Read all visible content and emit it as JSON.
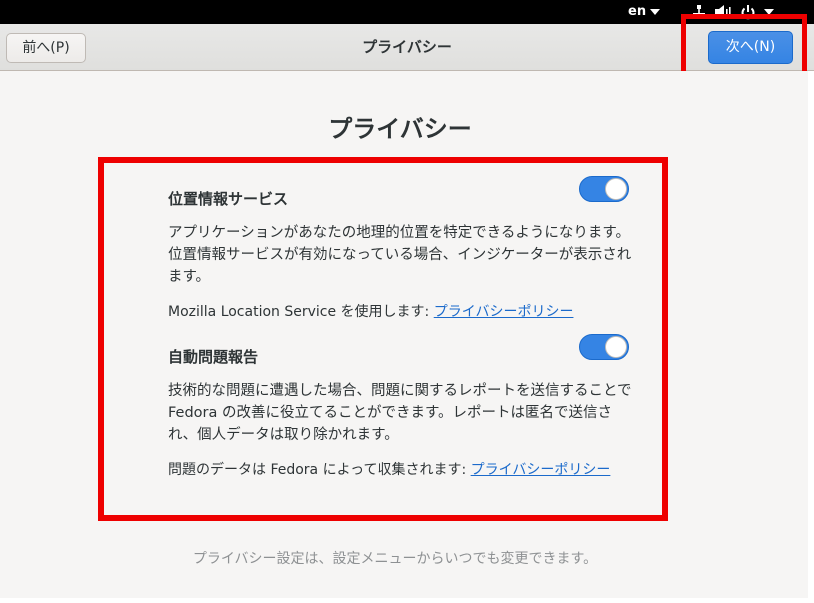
{
  "system": {
    "lang": "en",
    "icons": [
      "network-wired-icon",
      "volume-icon",
      "power-icon",
      "chevron-down-icon"
    ]
  },
  "header": {
    "prev_label": "前へ(P)",
    "title": "プライバシー",
    "next_label": "次へ(N)"
  },
  "main": {
    "heading": "プライバシー",
    "location": {
      "title": "位置情報サービス",
      "enabled": true,
      "description": "アプリケーションがあなたの地理的位置を特定できるようになります。位置情報サービスが有効になっている場合、インジケーターが表示されます。",
      "policy_prefix": "Mozilla Location Service を使用します: ",
      "policy_link": "プライバシーポリシー"
    },
    "problem_reporting": {
      "title": "自動問題報告",
      "enabled": true,
      "description": "技術的な問題に遭遇した場合、問題に関するレポートを送信することで Fedora の改善に役立てることができます。レポートは匿名で送信され、個人データは取り除かれます。",
      "policy_prefix": "問題のデータは Fedora によって収集されます: ",
      "policy_link": "プライバシーポリシー"
    },
    "footer_note": "プライバシー設定は、設定メニューからいつでも変更できます。"
  },
  "colors": {
    "accent": "#3584e4",
    "highlight": "#ee0000",
    "link": "#1b6acb"
  }
}
